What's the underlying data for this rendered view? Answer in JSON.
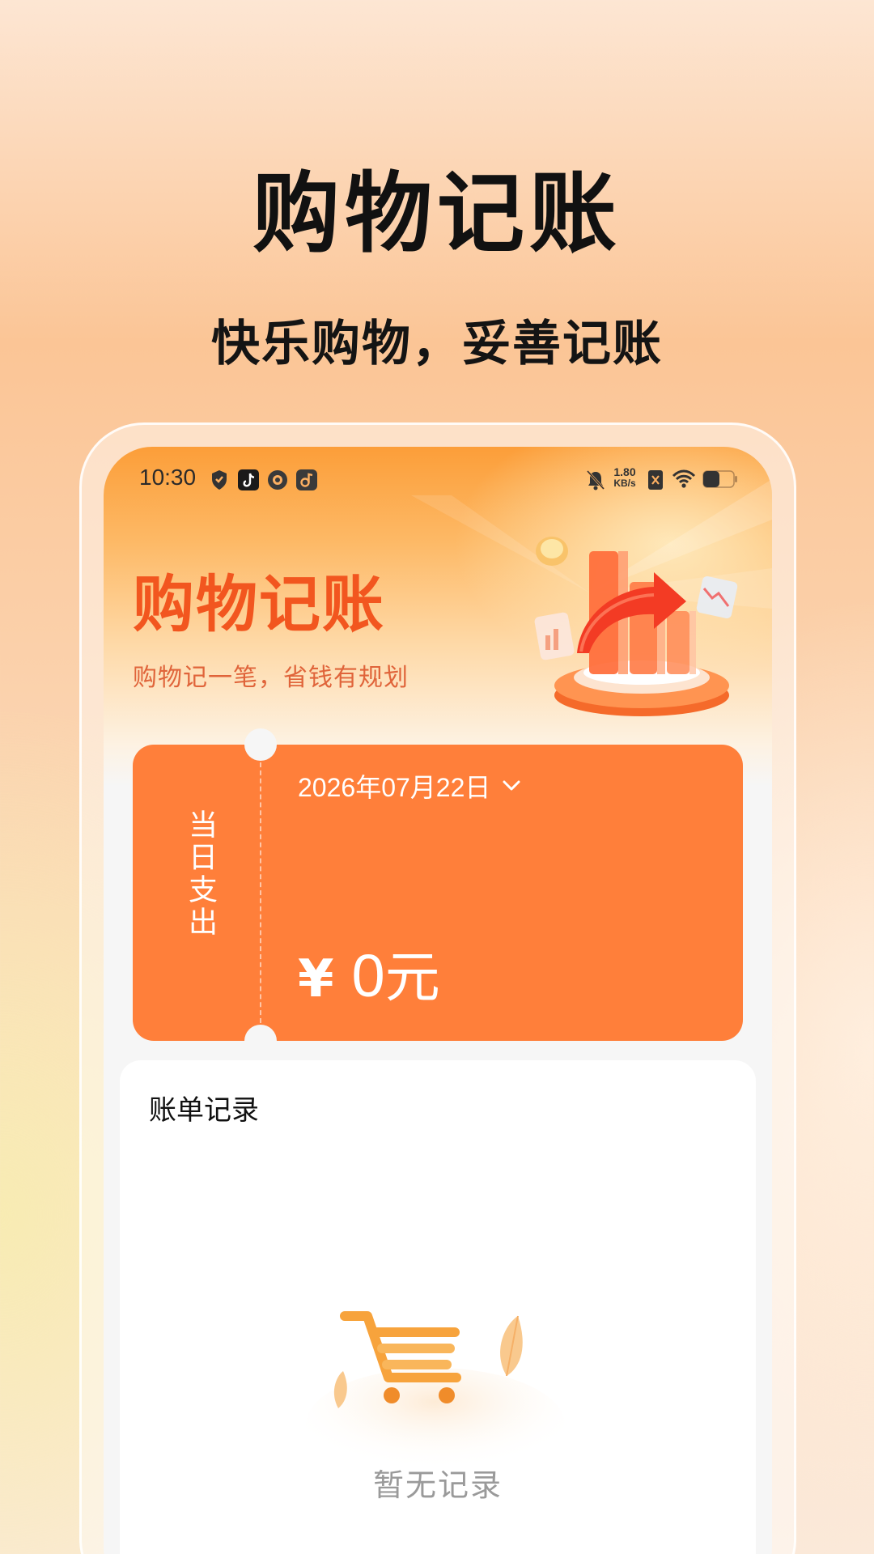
{
  "promo": {
    "title": "购物记账",
    "subtitle": "快乐购物，妥善记账"
  },
  "status_bar": {
    "time": "10:30",
    "net_speed_value": "1.80",
    "net_speed_unit": "KB/s",
    "icons": [
      "shield-icon",
      "tiktok-icon",
      "camera-app-icon",
      "music-app-icon",
      "bell-muted-icon",
      "sim-off-icon",
      "wifi-icon",
      "battery-icon"
    ]
  },
  "header": {
    "title": "购物记账",
    "subtitle": "购物记一笔，省钱有规划"
  },
  "expense_card": {
    "side_label": "当日支出",
    "date": "2026年07月22日",
    "currency": "¥",
    "amount": "0",
    "unit": "元"
  },
  "records": {
    "title": "账单记录",
    "empty_text": "暂无记录"
  },
  "colors": {
    "accent_orange": "#ff7f3a",
    "title_orange": "#f2561f",
    "header_gradient_top": "#fc9e39"
  }
}
